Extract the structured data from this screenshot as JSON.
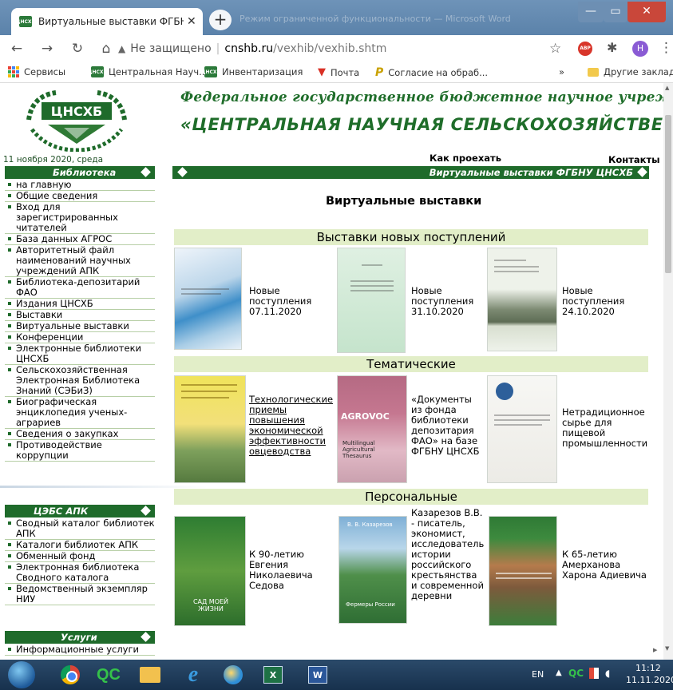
{
  "browser": {
    "tab_title": "Виртуальные выставки ФГБНУ Ц",
    "tab_close": "✕",
    "new_tab": "+",
    "inactive_tab": "Режим ограниченной функциональности — Microsoft Word",
    "window_minimize": "—",
    "window_maximize": "▭",
    "window_close": "✕",
    "url_security": "Не защищено",
    "url_separator": "|",
    "url_host": "cnshb.ru",
    "url_path": "/vexhib/vexhib.shtm",
    "profile_initial": "Н",
    "adblock_label": "ABP",
    "favicon_label": "ЦНСХБ"
  },
  "bookmarks": {
    "services": "Сервисы",
    "central": "Центральная Науч...",
    "inventory": "Инвентаризация",
    "mail": "Почта",
    "consent": "Согласие на обраб...",
    "more": "»",
    "other": "Другие закладки"
  },
  "header": {
    "logo_text": "ЦНСХБ",
    "line1": "Федеральное государственное бюджетное научное учреждени",
    "line2": "«ЦЕНТРАЛЬНАЯ НАУЧНАЯ СЕЛЬСКОХОЗЯЙСТВЕННА",
    "date": "11 ноября 2020, среда",
    "howto": "Как проехать",
    "contacts": "Контакты"
  },
  "sidebar": {
    "library_title": "Библиотека",
    "library_items": [
      "на главную",
      "Общие сведения",
      "Вход для зарегистрированных читателей",
      "База данных АГРОС",
      "Авторитетный файл наименований научных учреждений АПК",
      "Библиотека-депозитарий ФАО",
      "Издания ЦНСХБ",
      "Выставки",
      "Виртуальные выставки",
      "Конференции",
      "Электронные библиотеки ЦНСХБ",
      "Сельскохозяйственная Электронная Библиотека Знаний (СЭБиЗ)",
      "Биографическая энциклопедия ученых-аграриев",
      "Сведения о закупках",
      "Противодействие коррупции"
    ],
    "cesap_title": "ЦЭБС АПК",
    "cesap_items": [
      "Сводный каталог библиотек АПК",
      "Каталоги библиотек АПК",
      "Обменный фонд",
      "Электронная библиотека Сводного каталога",
      "Ведомственный экземпляр НИУ"
    ],
    "services_title": "Услуги",
    "services_items": [
      "Информационные услуги"
    ]
  },
  "main": {
    "section_header": "Виртуальные выставки ФГБНУ ЦНСХБ",
    "title": "Виртуальные выставки",
    "sections": [
      {
        "title": "Выставки новых поступлений",
        "items": [
          {
            "caption": "Новые поступления 07.11.2020"
          },
          {
            "caption": "Новые поступления 31.10.2020"
          },
          {
            "caption": "Новые поступления 24.10.2020"
          }
        ]
      },
      {
        "title": "Тематические",
        "items": [
          {
            "caption": "Технологические приемы повышения экономической эффективности овцеводства"
          },
          {
            "caption": "«Документы из фонда библиотеки депозитария ФАО» на базе ФГБНУ ЦНСХБ"
          },
          {
            "caption": "Нетрадиционное сырье для пищевой промышленности"
          }
        ]
      },
      {
        "title": "Персональные",
        "items": [
          {
            "caption": "К 90-летию Евгения Николаевича Седова"
          },
          {
            "caption": "Казарезов В.В. - писатель, экономист, исследователь истории российского крестьянства и современной деревни"
          },
          {
            "caption": "К 65-летию Амерханова Харона Адиевича"
          }
        ]
      }
    ],
    "cover_texts": {
      "agrovoc": "AGROVOC",
      "agrovoc_sub": "Multilingual Agricultural Thesaurus",
      "sad": "САД МОЕЙ ЖИЗНИ",
      "farmers": "Фермеры России",
      "kazarezov": "В. В. Казарезов"
    }
  },
  "taskbar": {
    "qc": "QC",
    "excel": "X",
    "word": "W",
    "lang": "EN",
    "tray_arrow": "▲",
    "tray_qc": "QC",
    "time": "11:12",
    "date": "11.11.2020"
  },
  "colors": {
    "brand_green": "#1f6b2b",
    "section_bg": "#e2eec8",
    "header_text": "#1f6d2a"
  }
}
